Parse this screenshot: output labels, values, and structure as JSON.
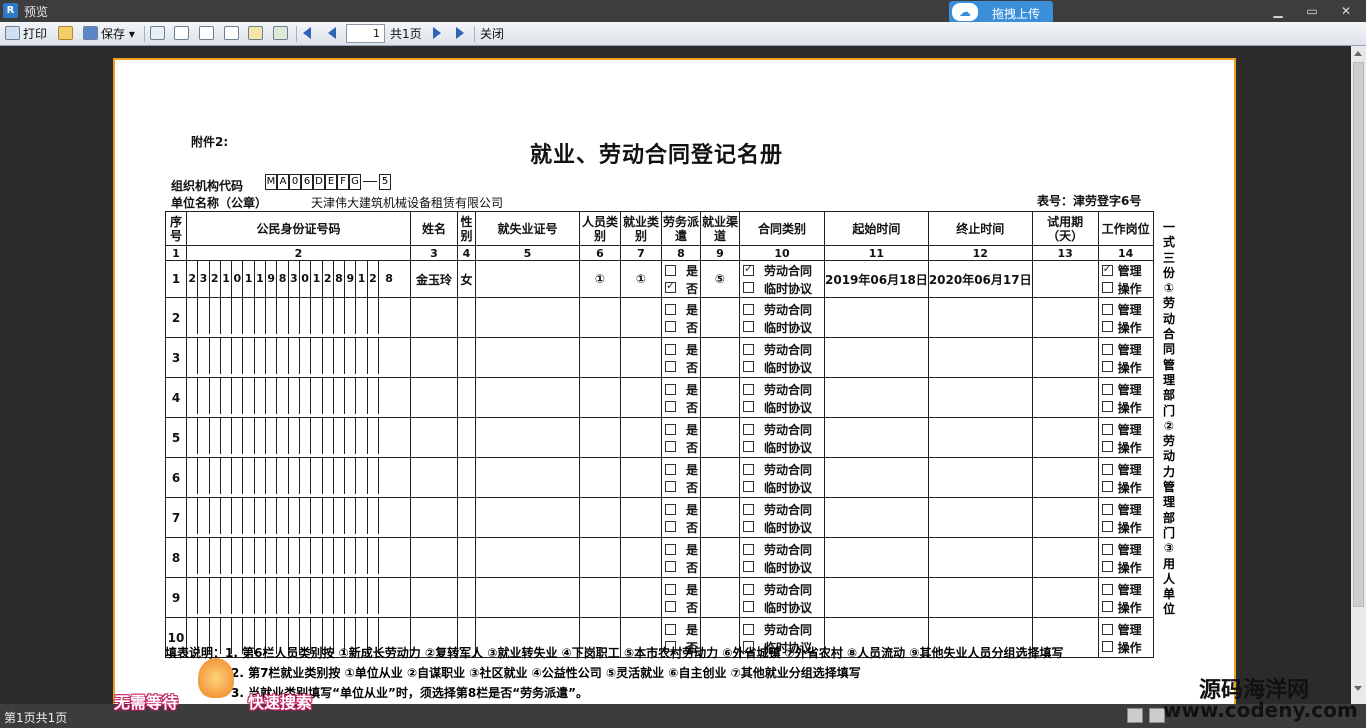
{
  "window": {
    "title": "预览",
    "upload_label": "拖拽上传",
    "logo_letter": "R"
  },
  "toolbar": {
    "print": "打印",
    "save": "保存",
    "page_value": "1",
    "page_total": "共1页",
    "close": "关闭"
  },
  "form": {
    "attachment": "附件2:",
    "title": "就业、劳动合同登记名册",
    "org_code_label": "组织机构代码",
    "org_code_chars": [
      "M",
      "A",
      "0",
      "6",
      "D",
      "E",
      "F",
      "G"
    ],
    "org_code_tail": "5",
    "unit_label": "单位名称（公章）",
    "unit_name": "天津伟大建筑机械设备租赁有限公司",
    "form_no": "表号：津劳登字6号",
    "headers": [
      "序号",
      "公民身份证号码",
      "姓名",
      "性别",
      "就失业证号",
      "人员类别",
      "就业类别",
      "劳务派遣",
      "就业渠道",
      "合同类别",
      "起始时间",
      "终止时间",
      "试用期（天）",
      "工作岗位"
    ],
    "col_numbers": [
      "1",
      "2",
      "3",
      "4",
      "5",
      "6",
      "7",
      "8",
      "9",
      "10",
      "11",
      "12",
      "13",
      "14"
    ],
    "opt_yes": "是",
    "opt_no": "否",
    "opt_contract": "劳动合同",
    "opt_temp": "临时协议",
    "opt_manage": "管理",
    "opt_operate": "操作",
    "rows": [
      {
        "no": "1",
        "id": [
          "2",
          "3",
          "2",
          "1",
          "0",
          "1",
          "1",
          "9",
          "8",
          "3",
          "0",
          "1",
          "2",
          "8",
          "9",
          "1",
          "2",
          "8"
        ],
        "name": "金玉玲",
        "gender": "女",
        "cert": "",
        "person_type": "①",
        "emp_type": "①",
        "dispatch": "否",
        "channel": "⑤",
        "contract": "劳动合同",
        "start": "2019年06月18日",
        "end": "2020年06月17日",
        "trial": "",
        "post": "管理"
      },
      {
        "no": "2"
      },
      {
        "no": "3"
      },
      {
        "no": "4"
      },
      {
        "no": "5"
      },
      {
        "no": "6"
      },
      {
        "no": "7"
      },
      {
        "no": "8"
      },
      {
        "no": "9"
      },
      {
        "no": "10"
      }
    ],
    "side_note": "一式三份①劳动合同管理部门②劳动力管理部门③用人单位",
    "notes": {
      "label": "填表说明：",
      "line1": "1. 第6栏人员类别按 ①新成长劳动力 ②复转军人 ③就业转失业 ④下岗职工 ⑤本市农村劳动力 ⑥外省城镇 ⑦外省农村 ⑧人员流动 ⑨其他失业人员分组选择填写",
      "line2": "2. 第7栏就业类别按 ①单位从业 ②自谋职业 ③社区就业 ④公益性公司 ⑤灵活就业 ⑥自主创业 ⑦其他就业分组选择填写",
      "line3": "3. 当就业类别填写“单位从业”时，须选择第8栏是否“劳务派遣”。"
    }
  },
  "status": {
    "page_info": "第1页共1页",
    "promo_left": "无需等待",
    "promo_right": "快速搜索"
  },
  "watermark": {
    "line1": "源码海洋网",
    "line2": "www.codeny.com"
  },
  "colors": {
    "page_border": "#f0a020",
    "upload_button": "#3b8fd9",
    "viewer_bg": "#2b2b2b"
  }
}
